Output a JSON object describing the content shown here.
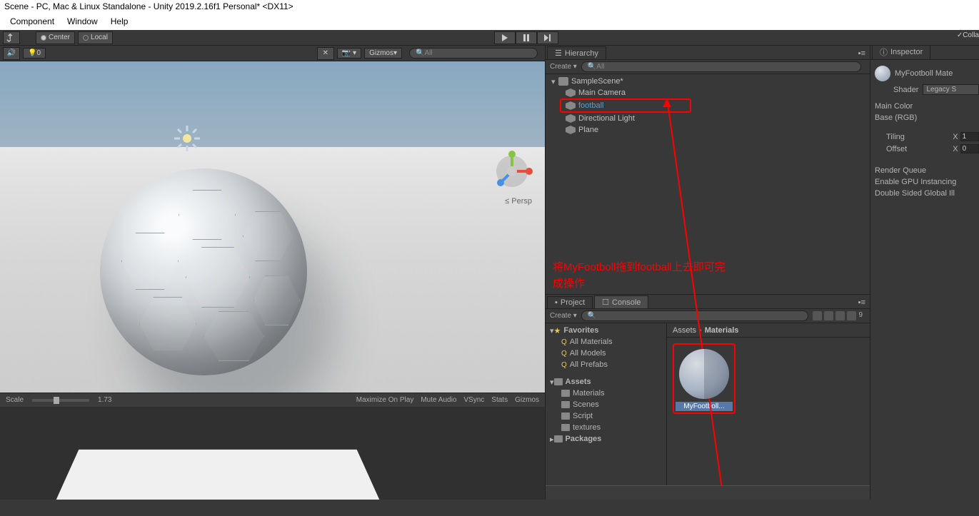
{
  "titlebar": "Scene - PC, Mac & Linux Standalone - Unity 2019.2.16f1 Personal* <DX11>",
  "menu": {
    "component": "Component",
    "window": "Window",
    "help": "Help"
  },
  "toolbar": {
    "center": "Center",
    "local": "Local",
    "collab": "Colla"
  },
  "scene_toolbar": {
    "gizmos": "Gizmos",
    "all": "All",
    "persp": "Persp",
    "zero": "0"
  },
  "hierarchy": {
    "title": "Hierarchy",
    "create": "Create",
    "search_placeholder": "All",
    "scene": "SampleScene*",
    "items": [
      "Main Camera",
      "football",
      "Directional Light",
      "Plane"
    ]
  },
  "annotation": {
    "line1": "将MyFootboll拖到football上去即可完",
    "line2": "成操作"
  },
  "project": {
    "title": "Project",
    "console": "Console",
    "create": "Create",
    "favorites": "Favorites",
    "fav_items": [
      "All Materials",
      "All Models",
      "All Prefabs"
    ],
    "assets": "Assets",
    "asset_folders": [
      "Materials",
      "Scenes",
      "Script",
      "textures"
    ],
    "packages": "Packages",
    "breadcrumb": {
      "root": "Assets",
      "current": "Materials"
    },
    "asset_name": "MyFootboll...",
    "count": "9"
  },
  "inspector": {
    "title": "Inspector",
    "mat_name": "MyFootboll Mate",
    "shader_label": "Shader",
    "shader_value": "Legacy S",
    "main_color": "Main Color",
    "base_rgb": "Base (RGB)",
    "tiling": "Tiling",
    "offset": "Offset",
    "x": "X",
    "tiling_x": "1",
    "offset_x": "0",
    "render_queue": "Render Queue",
    "gpu_instancing": "Enable GPU Instancing",
    "double_sided": "Double Sided Global Ill"
  },
  "game_bar": {
    "scale": "Scale",
    "scale_val": "1.73",
    "maximize": "Maximize On Play",
    "mute": "Mute Audio",
    "vsync": "VSync",
    "stats": "Stats",
    "gizmos": "Gizmos"
  }
}
